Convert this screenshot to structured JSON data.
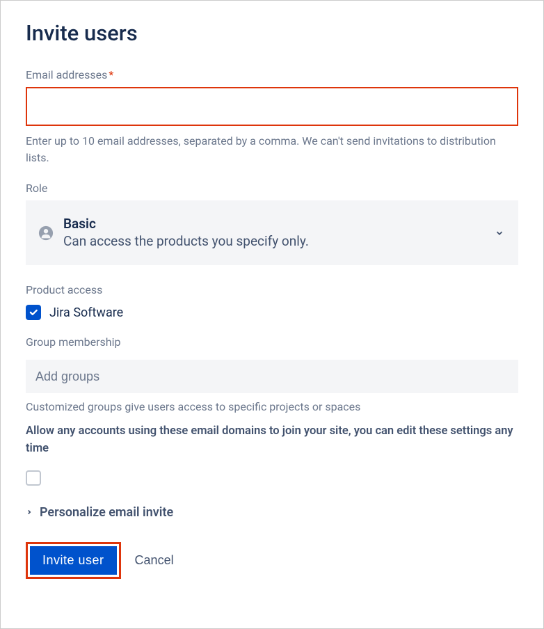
{
  "title": "Invite users",
  "email": {
    "label": "Email addresses",
    "required_mark": "*",
    "value": "",
    "help": "Enter up to 10 email addresses, separated by a comma. We can't send invitations to distribution lists."
  },
  "role": {
    "label": "Role",
    "selected_title": "Basic",
    "selected_desc": "Can access the products you specify only."
  },
  "product_access": {
    "label": "Product access",
    "items": [
      {
        "name": "Jira Software",
        "checked": true
      }
    ]
  },
  "group": {
    "label": "Group membership",
    "placeholder": "Add groups",
    "help": "Customized groups give users access to specific projects or spaces"
  },
  "allow_domains": {
    "text": "Allow any accounts using these email domains to join your site, you can edit these settings any time",
    "checked": false
  },
  "personalize": {
    "label": "Personalize email invite"
  },
  "buttons": {
    "invite": "Invite   user",
    "cancel": "Cancel"
  }
}
